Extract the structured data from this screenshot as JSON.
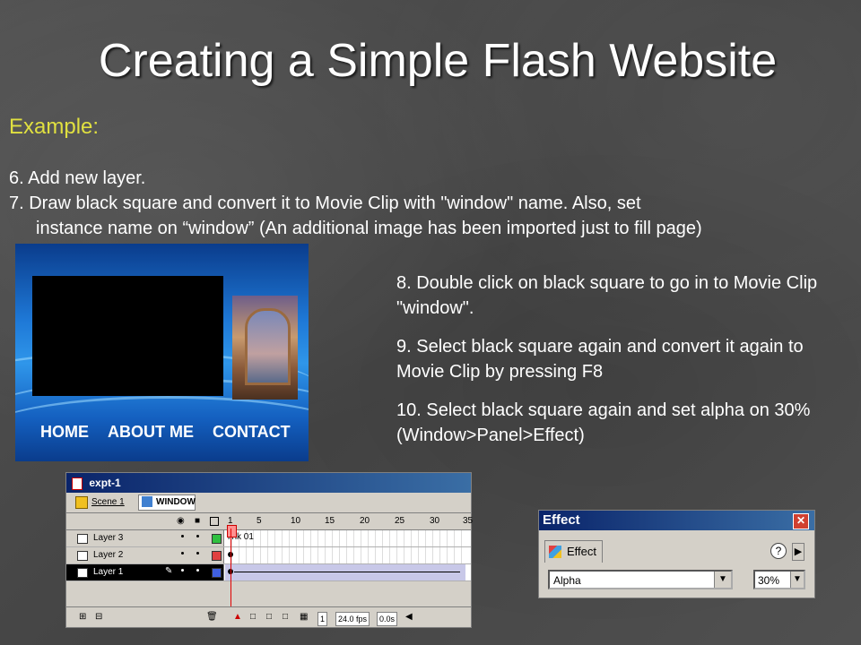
{
  "title": "Creating a Simple Flash Website",
  "example_label": "Example:",
  "steps": {
    "step6": "6. Add new layer.",
    "step7_line1": "7. Draw black square and convert it to Movie Clip with \"window\" name. Also, set",
    "step7_line2": "instance name on “window” (An additional image has been imported just to fill page)",
    "step8": "8. Double click on black square to go in to Movie Clip \"window\".",
    "step9": "9. Select black square again and convert it again to Movie Clip by pressing F8",
    "step10": "10. Select black square again and set alpha on 30% (Window>Panel>Effect)"
  },
  "preview": {
    "nav": [
      "HOME",
      "ABOUT ME",
      "CONTACT"
    ]
  },
  "ide": {
    "window_title": "expt-1",
    "scene": "Scene 1",
    "symbol": "WINDOW",
    "frame_numbers": [
      "1",
      "5",
      "10",
      "15",
      "20",
      "25",
      "30",
      "35"
    ],
    "frame_label": "link 01",
    "layers": [
      {
        "name": "Layer 3",
        "color": "#30c040"
      },
      {
        "name": "Layer 2",
        "color": "#e04040"
      },
      {
        "name": "Layer 1",
        "color": "#4060e0",
        "selected": true
      }
    ],
    "current_frame": "1",
    "fps": "24.0 fps",
    "time": "0.0s"
  },
  "effect_panel": {
    "title": "Effect",
    "tab": "Effect",
    "effect_value": "Alpha",
    "percent": "30%"
  }
}
